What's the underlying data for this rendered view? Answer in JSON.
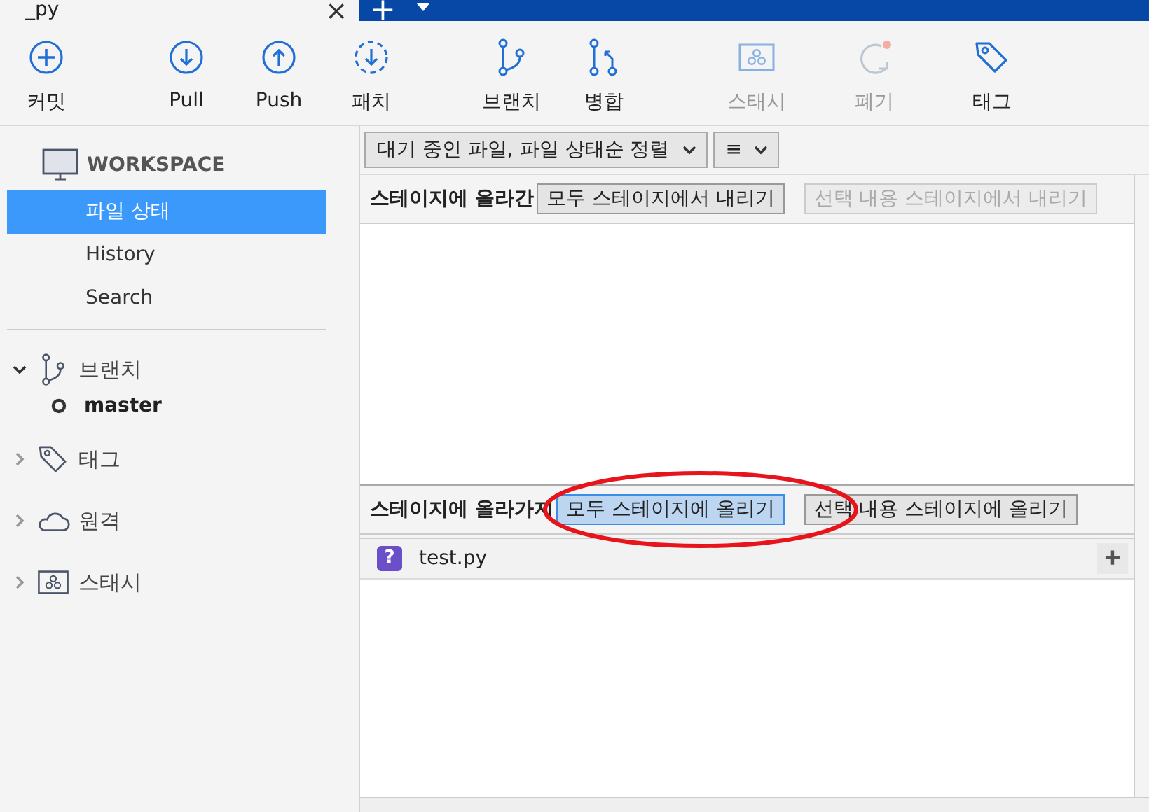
{
  "tab_bar": {
    "tab": {
      "title": "_py",
      "close": "×"
    },
    "new_tab": "+"
  },
  "toolbar": {
    "groups": [
      [
        {
          "label": "커밋",
          "disabled": false
        }
      ],
      [
        {
          "label": "Pull",
          "disabled": false
        },
        {
          "label": "Push",
          "disabled": false
        },
        {
          "label": "패치",
          "disabled": false
        }
      ],
      [
        {
          "label": "브랜치",
          "disabled": false
        },
        {
          "label": "병합",
          "disabled": false
        }
      ],
      [
        {
          "label": "스태시",
          "disabled": true
        },
        {
          "label": "폐기",
          "disabled": true
        },
        {
          "label": "태그",
          "disabled": false
        }
      ]
    ]
  },
  "sidebar": {
    "workspace": {
      "title": "WORKSPACE",
      "items": [
        {
          "label": "파일 상태",
          "selected": true
        },
        {
          "label": "History",
          "selected": false
        },
        {
          "label": "Search",
          "selected": false
        }
      ]
    },
    "sections": [
      {
        "label": "브랜치",
        "expanded": true,
        "children": [
          {
            "label": "master",
            "current": true
          }
        ]
      },
      {
        "label": "태그",
        "expanded": false
      },
      {
        "label": "원격",
        "expanded": false
      },
      {
        "label": "스태시",
        "expanded": false
      }
    ]
  },
  "filter_bar": {
    "sort_dropdown": "대기 중인 파일, 파일 상태순 정렬",
    "view_button": "≡"
  },
  "staged": {
    "title": "스테이지에 올라간",
    "buttons": [
      {
        "label": "모두 스테이지에서 내리기",
        "disabled": false,
        "focused": false
      },
      {
        "label": "선택 내용 스테이지에서 내리기",
        "disabled": true,
        "focused": false
      }
    ]
  },
  "unstaged": {
    "title": "스테이지에 올라가지",
    "buttons": [
      {
        "label": "모두 스테이지에 올리기",
        "disabled": false,
        "focused": true
      },
      {
        "label": "선택 내용 스테이지에 올리기",
        "disabled": false,
        "focused": false
      }
    ],
    "files": [
      {
        "status": "?",
        "name": "test.py",
        "action": "+"
      }
    ]
  },
  "annotation": {
    "kind": "ellipse",
    "color": "#e8141b"
  }
}
